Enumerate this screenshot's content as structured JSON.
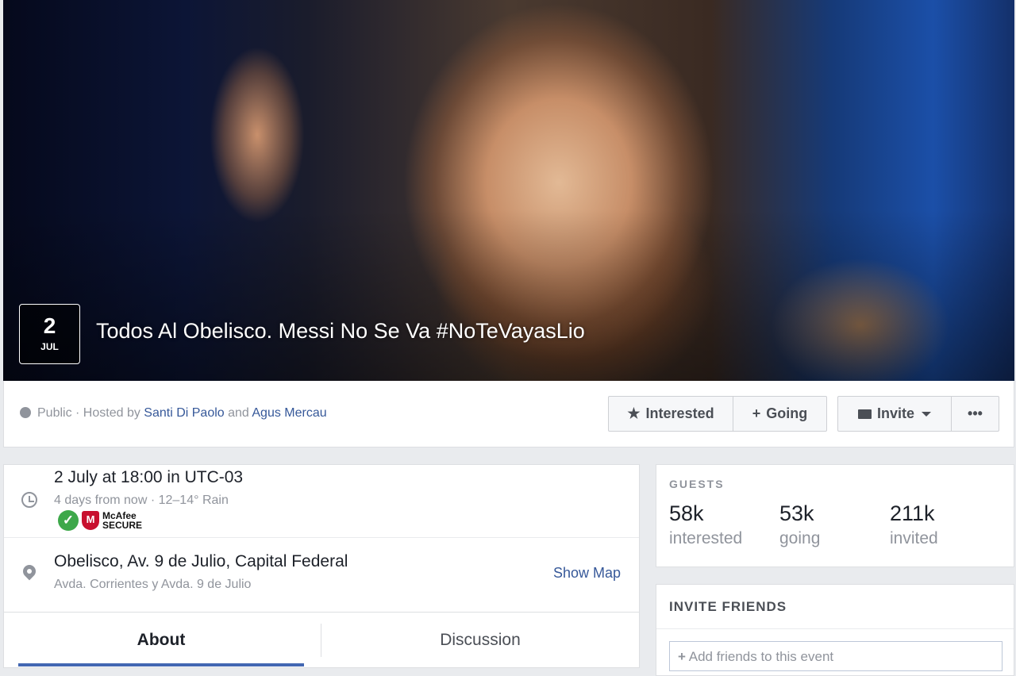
{
  "event": {
    "day": "2",
    "month": "JUL",
    "title": "Todos Al Obelisco. Messi No Se Va #NoTeVayasLio"
  },
  "meta": {
    "privacy": "Public",
    "hosted_by_text": " · Hosted by ",
    "host1": "Santi Di Paolo",
    "and_text": " and ",
    "host2": "Agus Mercau"
  },
  "actions": {
    "interested": "Interested",
    "going": "Going",
    "invite": "Invite",
    "more": "•••"
  },
  "details": {
    "datetime": "2 July at 18:00 in UTC-03",
    "relative": "4 days from now · 12–14° Rain",
    "badge_top": "McAfee",
    "badge_bottom": "SECURE",
    "location": "Obelisco, Av. 9 de Julio, Capital Federal",
    "address": "Avda. Corrientes y Avda. 9 de Julio",
    "show_map": "Show Map"
  },
  "tabs": [
    "About",
    "Discussion"
  ],
  "guests": {
    "label": "GUESTS",
    "stats": [
      {
        "num": "58k",
        "label": "interested"
      },
      {
        "num": "53k",
        "label": "going"
      },
      {
        "num": "211k",
        "label": "invited"
      }
    ]
  },
  "invite_friends": {
    "title": "INVITE FRIENDS",
    "placeholder": "Add friends to this event"
  },
  "colors": {
    "link": "#365899",
    "accent": "#4267b2",
    "check": "#3da84a",
    "mcafee": "#c8102e"
  }
}
